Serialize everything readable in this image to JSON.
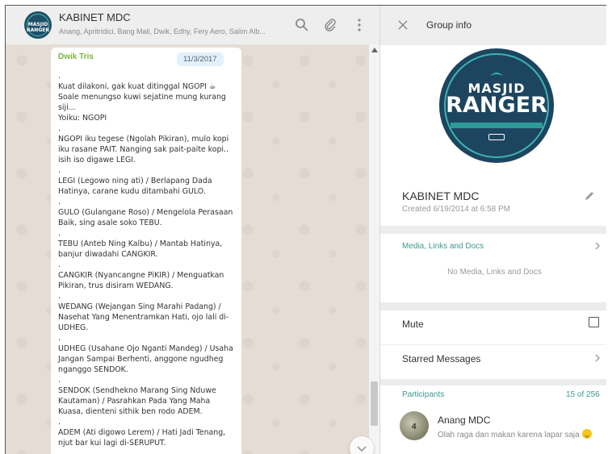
{
  "chat": {
    "avatar_text": "MASJID RANGER",
    "title": "KABINET MDC",
    "subtitle": "Anang, Apritridici, Bang Mail, Dwik, Edhy, Fery Aero, Salim Alb...",
    "header_icons": [
      "search-icon",
      "attach-icon",
      "menu-icon"
    ]
  },
  "message": {
    "sender": "Dwik Tris",
    "date": "11/3/2017",
    "text": ".\nKuat dilakoni, gak kuat ditinggal NGOPI ☕ Soale menungso kuwi sejatine mung kurang siji...\nYoiku: NGOPI\n.\nNGOPI iku tegese (Ngolah Pikiran), mulo kopi iku rasane PAIT. Nanging sak pait-paite kopi.. isih iso digawe LEGI.\n.\nLEGI (Legowo ning ati) / Berlapang Dada Hatinya, carane kudu ditambahi GULO.\n.\nGULO (Gulangane Roso) / Mengelola Perasaan Baik, sing asale soko TEBU.\n.\nTEBU (Anteb Ning Kalbu) / Mantab Hatinya, banjur diwadahi CANGKIR.\n.\nCANGKIR (Nyancangne PiKIR) / Menguatkan Pikiran, trus disiram WEDANG.\n.\nWEDANG (Wejangan Sing Marahi Padang) / Nasehat Yang Menentramkan Hati, ojo lali di-UDHEG.\n.\nUDHEG (Usahane Ojo Nganti Mandeg) / Usaha Jangan Sampai Berhenti, anggone ngudheg nganggo SENDOK.\n.\nSENDOK (Sendhekno Marang Sing Nduwe Kautaman) / Pasrahkan Pada Yang Maha Kuasa, dienteni sithik ben rodo ADEM.\n.\nADEM (Ati digowo Lerem) / Hati Jadi Tenang, njut bar kui lagi di-SERUPUT.\n."
  },
  "info": {
    "close_icon": "close-icon",
    "title": "Group info",
    "logo": {
      "line1": "MASJID",
      "line2": "RANGER"
    },
    "group_name": "KABINET MDC",
    "created": "Created 6/19/2014 at 6:58 PM",
    "media_label": "Media, Links and Docs",
    "no_media": "No Media, Links and Docs",
    "mute_label": "Mute",
    "mute_checked": false,
    "starred_label": "Starred Messages",
    "participants_label": "Participants",
    "participants_count": "15 of 256",
    "participant": {
      "name": "Anang MDC",
      "status": "Olah raga dan makan karena lapar saja",
      "avatar_text": "4"
    }
  },
  "colors": {
    "accent": "#3a9a8f",
    "sender": "#7cb342",
    "chat_bg": "#e5ddd5",
    "logo_bg": "#1d4560"
  }
}
